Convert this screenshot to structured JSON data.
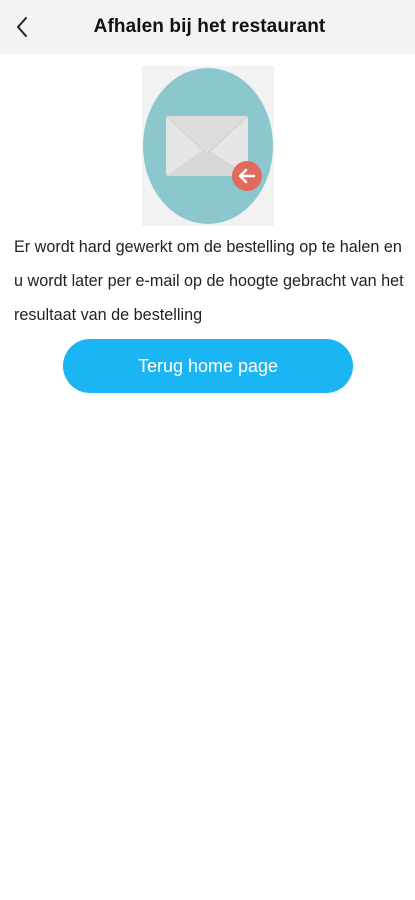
{
  "header": {
    "title": "Afhalen bij het restaurant",
    "back_icon": "chevron-left-icon"
  },
  "hero": {
    "icon": "mail-return-icon",
    "circle_color": "#8cc7ce",
    "badge_color": "#e36a5a"
  },
  "message": {
    "text": "Er wordt hard gewerkt om de bestelling op te halen en u wordt later per e-mail op de hoogte gebracht van het resultaat van de bestelling"
  },
  "actions": {
    "home_label": "Terug home page",
    "home_color": "#1cb5f3"
  }
}
